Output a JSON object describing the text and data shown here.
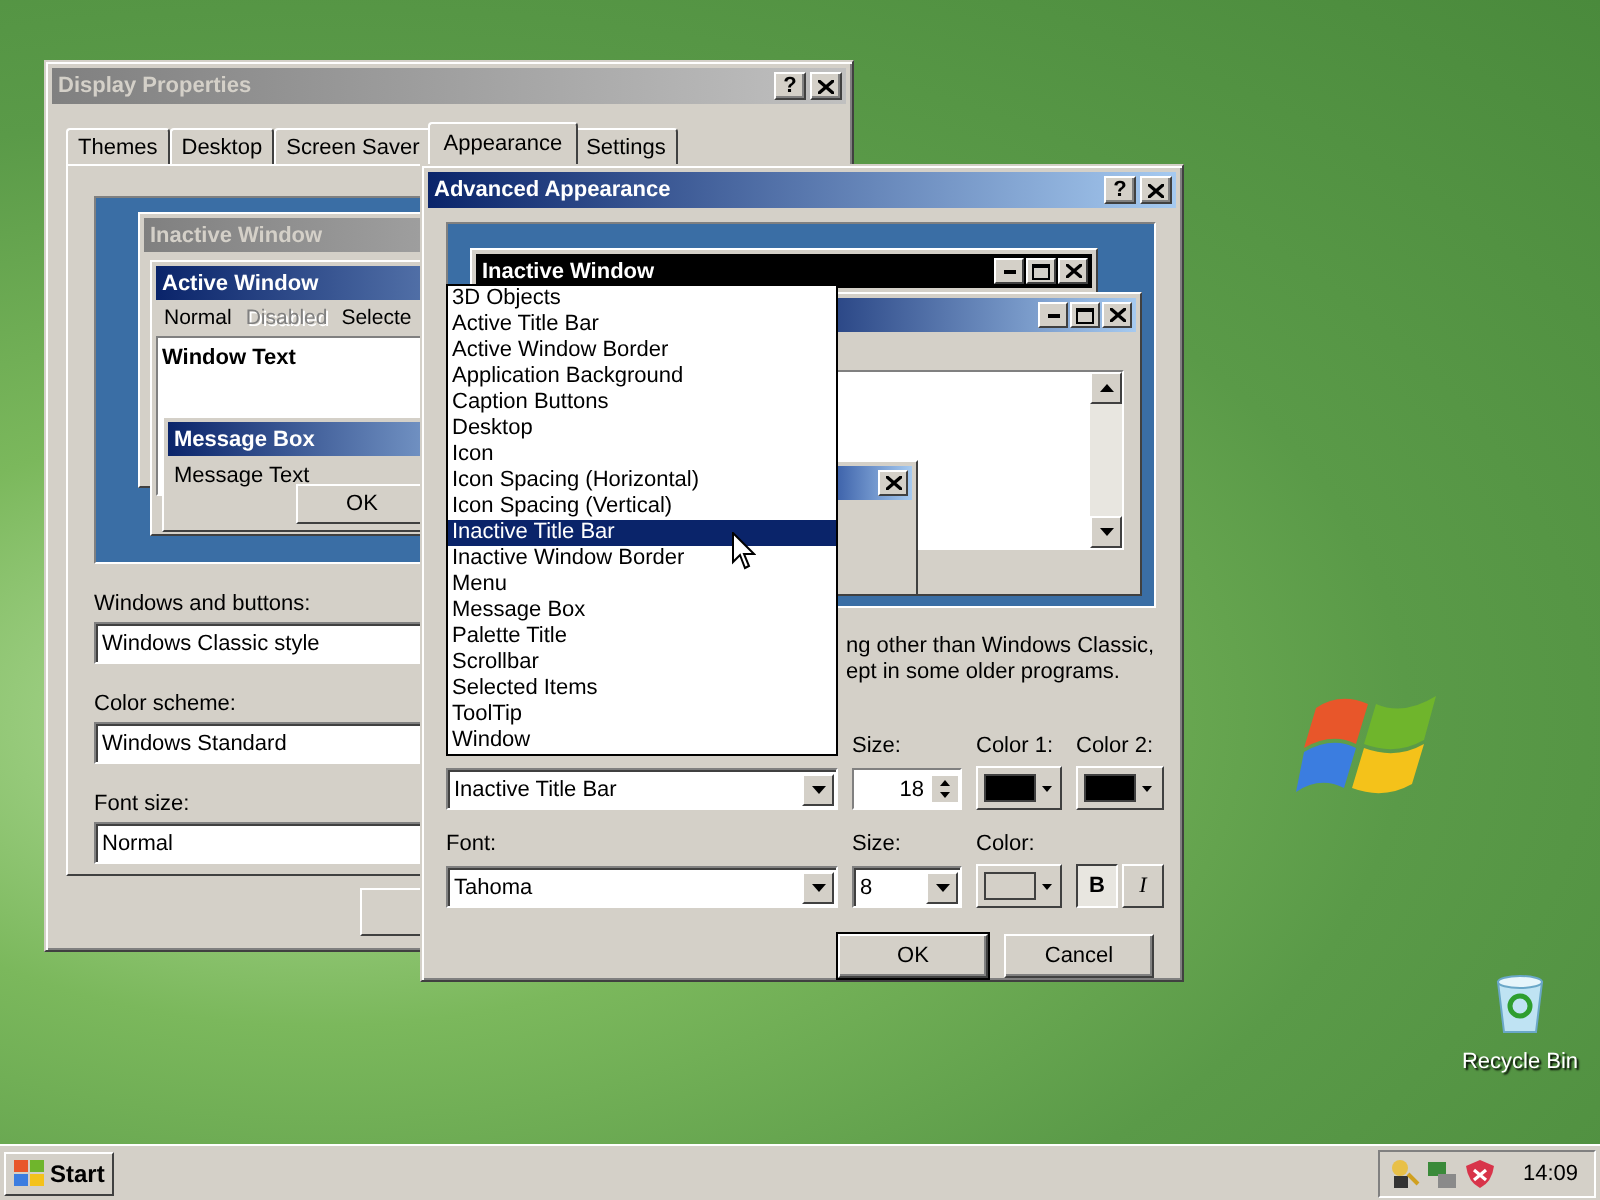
{
  "desktop_icons": [
    {
      "label": "Recycle Bin"
    }
  ],
  "display_properties": {
    "title": "Display Properties",
    "help": "?",
    "tabs": [
      {
        "label": "Themes",
        "selected": false
      },
      {
        "label": "Desktop",
        "selected": false
      },
      {
        "label": "Screen Saver",
        "selected": false
      },
      {
        "label": "Appearance",
        "selected": true
      },
      {
        "label": "Settings",
        "selected": false
      }
    ],
    "preview": {
      "inactive_title": "Inactive Window",
      "active_title": "Active Window",
      "menu": [
        {
          "label": "Normal",
          "disabled": false
        },
        {
          "label": "Disabled",
          "disabled": true
        },
        {
          "label": "Selecte",
          "disabled": false
        }
      ],
      "window_text": "Window Text",
      "message_title": "Message Box",
      "message_text": "Message Text",
      "button": "OK"
    },
    "fields": [
      {
        "label": "Windows and buttons:",
        "value": "Windows Classic style"
      },
      {
        "label": "Color scheme:",
        "value": "Windows Standard"
      },
      {
        "label": "Font size:",
        "value": "Normal"
      }
    ]
  },
  "advanced_appearance": {
    "title": "Advanced Appearance",
    "help": "?",
    "preview": {
      "inactive_title": "Inactive Window"
    },
    "item_list": [
      {
        "label": "3D Objects",
        "selected": false
      },
      {
        "label": "Active Title Bar",
        "selected": false
      },
      {
        "label": "Active Window Border",
        "selected": false
      },
      {
        "label": "Application Background",
        "selected": false
      },
      {
        "label": "Caption Buttons",
        "selected": false
      },
      {
        "label": "Desktop",
        "selected": false
      },
      {
        "label": "Icon",
        "selected": false
      },
      {
        "label": "Icon Spacing (Horizontal)",
        "selected": false
      },
      {
        "label": "Icon Spacing (Vertical)",
        "selected": false
      },
      {
        "label": "Inactive Title Bar",
        "selected": true
      },
      {
        "label": "Inactive Window Border",
        "selected": false
      },
      {
        "label": "Menu",
        "selected": false
      },
      {
        "label": "Message Box",
        "selected": false
      },
      {
        "label": "Palette Title",
        "selected": false
      },
      {
        "label": "Scrollbar",
        "selected": false
      },
      {
        "label": "Selected Items",
        "selected": false
      },
      {
        "label": "ToolTip",
        "selected": false
      },
      {
        "label": "Window",
        "selected": false
      }
    ],
    "note": [
      "ng other than Windows Classic,",
      "ept in some older programs."
    ],
    "item": {
      "value": "Inactive Title Bar"
    },
    "item_size": {
      "label": "Size:",
      "value": "18"
    },
    "color_1": {
      "label": "Color 1:",
      "color": "#000000"
    },
    "color_2": {
      "label": "Color 2:",
      "color": "#000000"
    },
    "font": {
      "label": "Font:",
      "value": "Tahoma"
    },
    "font_size": {
      "label": "Size:",
      "value": "8"
    },
    "font_color": {
      "label": "Color:",
      "color": "#d4d0c8"
    },
    "bold": {
      "label": "B",
      "on": true
    },
    "italic": {
      "label": "I",
      "on": false
    },
    "buttons": [
      {
        "label": "OK",
        "default": true
      },
      {
        "label": "Cancel",
        "default": false
      }
    ]
  },
  "taskbar": {
    "start": "Start",
    "clock": "14:09"
  }
}
